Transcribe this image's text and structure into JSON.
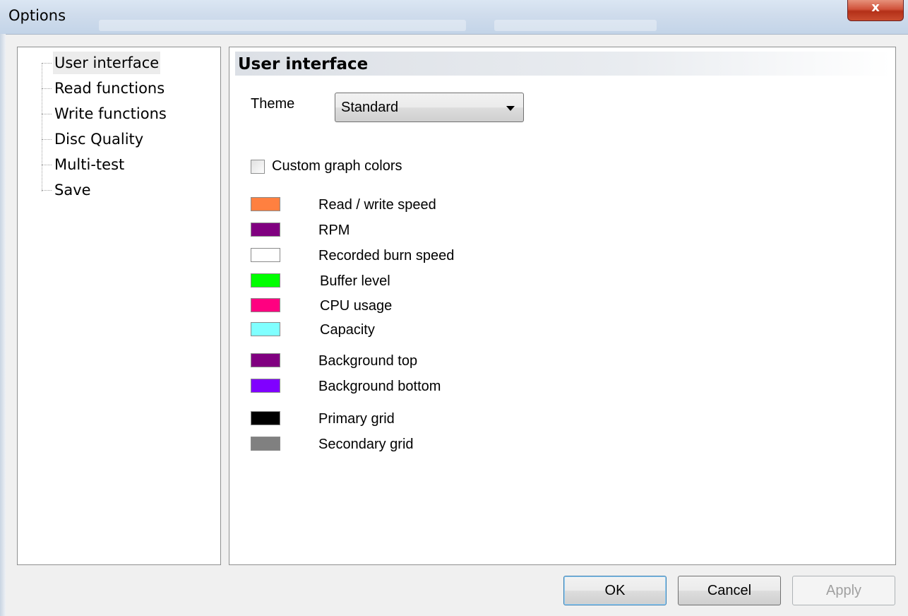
{
  "window": {
    "title": "Options",
    "close_glyph": "x"
  },
  "tree": {
    "items": [
      {
        "label": "User interface",
        "selected": true
      },
      {
        "label": "Read functions"
      },
      {
        "label": "Write functions"
      },
      {
        "label": "Disc Quality"
      },
      {
        "label": "Multi-test"
      },
      {
        "label": "Save"
      }
    ]
  },
  "panel": {
    "header": "User interface",
    "theme_label": "Theme",
    "theme_value": "Standard",
    "custom_colors_label": "Custom graph colors",
    "custom_colors_checked": false,
    "colors": [
      {
        "label": "Read / write speed",
        "color": "#ff8040"
      },
      {
        "label": "RPM",
        "color": "#800080"
      },
      {
        "label": "Recorded burn speed",
        "color": "#ffffff"
      },
      {
        "label": "Buffer level",
        "color": "#00ff00"
      },
      {
        "label": "CPU usage",
        "color": "#ff0080"
      },
      {
        "label": "Capacity",
        "color": "#80ffff"
      },
      {
        "label": "Background top",
        "color": "#800080"
      },
      {
        "label": "Background bottom",
        "color": "#8000ff"
      },
      {
        "label": "Primary grid",
        "color": "#000000"
      },
      {
        "label": "Secondary grid",
        "color": "#808080"
      }
    ]
  },
  "buttons": {
    "ok": "OK",
    "cancel": "Cancel",
    "apply": "Apply"
  }
}
